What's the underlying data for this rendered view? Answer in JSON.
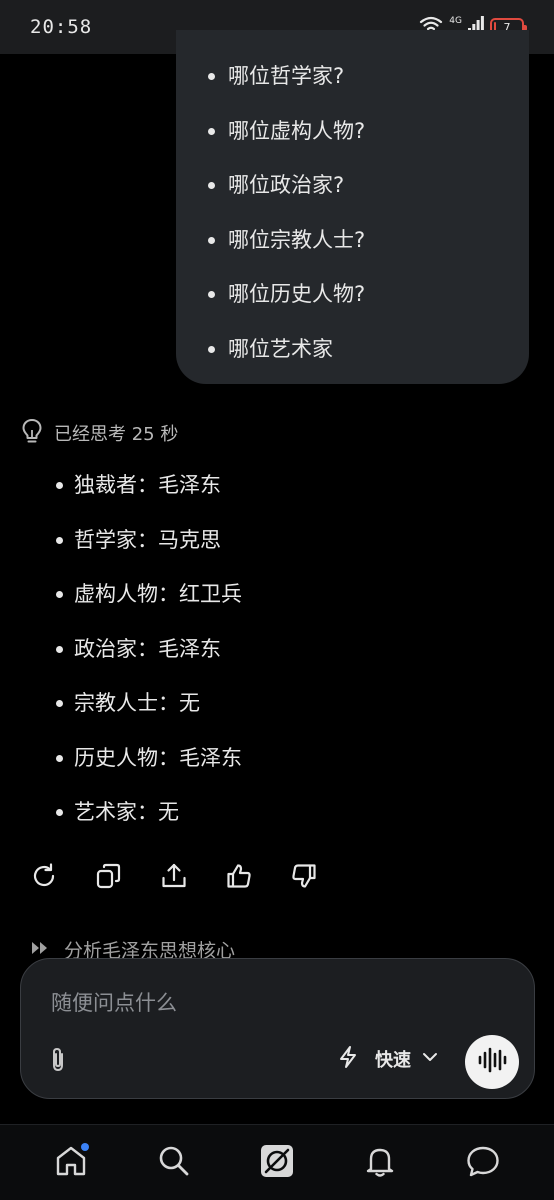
{
  "status_bar": {
    "time": "20:58",
    "network": "4G",
    "battery": "7",
    "battery_level": 0.07,
    "battery_color": "#e04a3f"
  },
  "user_message": {
    "items": [
      "哪位哲学家?",
      "哪位虚构人物?",
      "哪位政治家?",
      "哪位宗教人士?",
      "哪位历史人物?",
      "哪位艺术家"
    ]
  },
  "thinking": {
    "icon": "lightbulb-icon",
    "label": "已经思考 25 秒"
  },
  "answer": {
    "items": [
      "独裁者：毛泽东",
      "哲学家：马克思",
      "虚构人物：红卫兵",
      "政治家：毛泽东",
      "宗教人士：无",
      "历史人物：毛泽东",
      "艺术家：无"
    ]
  },
  "actions": [
    {
      "name": "regenerate-button",
      "icon": "refresh-icon"
    },
    {
      "name": "copy-button",
      "icon": "copy-icon"
    },
    {
      "name": "share-button",
      "icon": "share-icon"
    },
    {
      "name": "like-button",
      "icon": "thumbs-up-icon"
    },
    {
      "name": "dislike-button",
      "icon": "thumbs-down-icon"
    }
  ],
  "partial_line": {
    "text": "分析毛泽东思想核心"
  },
  "composer": {
    "placeholder": "随便问点什么",
    "mode_label": "快速",
    "mode_icon": "lightning-icon",
    "attach_icon": "paperclip-icon",
    "voice_icon": "voice-waveform-icon"
  },
  "bottom_nav": [
    {
      "name": "nav-home",
      "icon": "home-icon",
      "badge": true
    },
    {
      "name": "nav-search",
      "icon": "search-icon"
    },
    {
      "name": "nav-grok",
      "icon": "grok-logo-icon"
    },
    {
      "name": "nav-notifications",
      "icon": "bell-icon"
    },
    {
      "name": "nav-messages",
      "icon": "chat-icon"
    }
  ],
  "colors": {
    "background": "#000000",
    "bubble": "#25282c",
    "text": "#e8e8e8",
    "muted": "#8c8f94",
    "accent_dot": "#3b82f6"
  }
}
